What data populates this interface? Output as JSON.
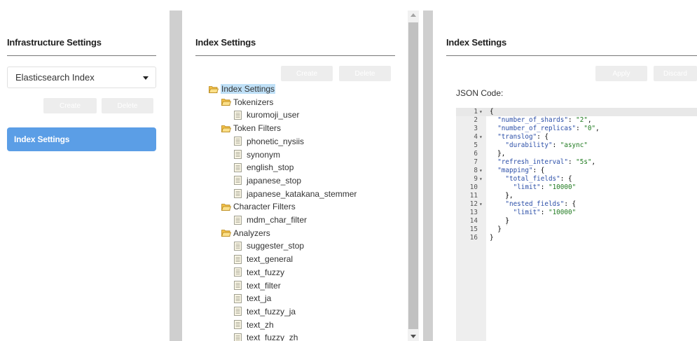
{
  "left_panel": {
    "title": "Infrastructure Settings",
    "dropdown_value": "Elasticsearch Index",
    "create_label": "Create",
    "delete_label": "Delete",
    "nav_item_label": "Index Settings"
  },
  "middle_panel": {
    "title": "Index Settings",
    "create_label": "Create",
    "delete_label": "Delete",
    "tree": [
      {
        "label": "Index Settings",
        "type": "folder",
        "level": 0,
        "selected": true
      },
      {
        "label": "Tokenizers",
        "type": "folder",
        "level": 1
      },
      {
        "label": "kuromoji_user",
        "type": "file",
        "level": 2
      },
      {
        "label": "Token Filters",
        "type": "folder",
        "level": 1
      },
      {
        "label": "phonetic_nysiis",
        "type": "file",
        "level": 2
      },
      {
        "label": "synonym",
        "type": "file",
        "level": 2
      },
      {
        "label": "english_stop",
        "type": "file",
        "level": 2
      },
      {
        "label": "japanese_stop",
        "type": "file",
        "level": 2
      },
      {
        "label": "japanese_katakana_stemmer",
        "type": "file",
        "level": 2
      },
      {
        "label": "Character Filters",
        "type": "folder",
        "level": 1
      },
      {
        "label": "mdm_char_filter",
        "type": "file",
        "level": 2
      },
      {
        "label": "Analyzers",
        "type": "folder",
        "level": 1
      },
      {
        "label": "suggester_stop",
        "type": "file",
        "level": 2
      },
      {
        "label": "text_general",
        "type": "file",
        "level": 2
      },
      {
        "label": "text_fuzzy",
        "type": "file",
        "level": 2
      },
      {
        "label": "text_filter",
        "type": "file",
        "level": 2
      },
      {
        "label": "text_ja",
        "type": "file",
        "level": 2
      },
      {
        "label": "text_fuzzy_ja",
        "type": "file",
        "level": 2
      },
      {
        "label": "text_zh",
        "type": "file",
        "level": 2
      },
      {
        "label": "text_fuzzy_zh",
        "type": "file",
        "level": 2
      }
    ]
  },
  "right_panel": {
    "title": "Index Settings",
    "apply_label": "Apply",
    "discard_label": "Discard",
    "json_label": "JSON Code:",
    "code_lines": [
      {
        "n": "1",
        "fold": true,
        "text": "{"
      },
      {
        "n": "2",
        "fold": false,
        "text": "  \"number_of_shards\": \"2\","
      },
      {
        "n": "3",
        "fold": false,
        "text": "  \"number_of_replicas\": \"0\","
      },
      {
        "n": "4",
        "fold": true,
        "text": "  \"translog\": {"
      },
      {
        "n": "5",
        "fold": false,
        "text": "    \"durability\": \"async\""
      },
      {
        "n": "6",
        "fold": false,
        "text": "  },"
      },
      {
        "n": "7",
        "fold": false,
        "text": "  \"refresh_interval\": \"5s\","
      },
      {
        "n": "8",
        "fold": true,
        "text": "  \"mapping\": {"
      },
      {
        "n": "9",
        "fold": true,
        "text": "    \"total_fields\": {"
      },
      {
        "n": "10",
        "fold": false,
        "text": "      \"limit\": \"10000\""
      },
      {
        "n": "11",
        "fold": false,
        "text": "    },"
      },
      {
        "n": "12",
        "fold": true,
        "text": "    \"nested_fields\": {"
      },
      {
        "n": "13",
        "fold": false,
        "text": "      \"limit\": \"10000\""
      },
      {
        "n": "14",
        "fold": false,
        "text": "    }"
      },
      {
        "n": "15",
        "fold": false,
        "text": "  }"
      },
      {
        "n": "16",
        "fold": false,
        "text": "}"
      }
    ]
  },
  "colors": {
    "accent": "#5b9ee6",
    "selection": "#bfe0f7",
    "disabled_button": "#ededed",
    "json_key": "#2c4fa8",
    "json_string": "#1f7a1f"
  }
}
